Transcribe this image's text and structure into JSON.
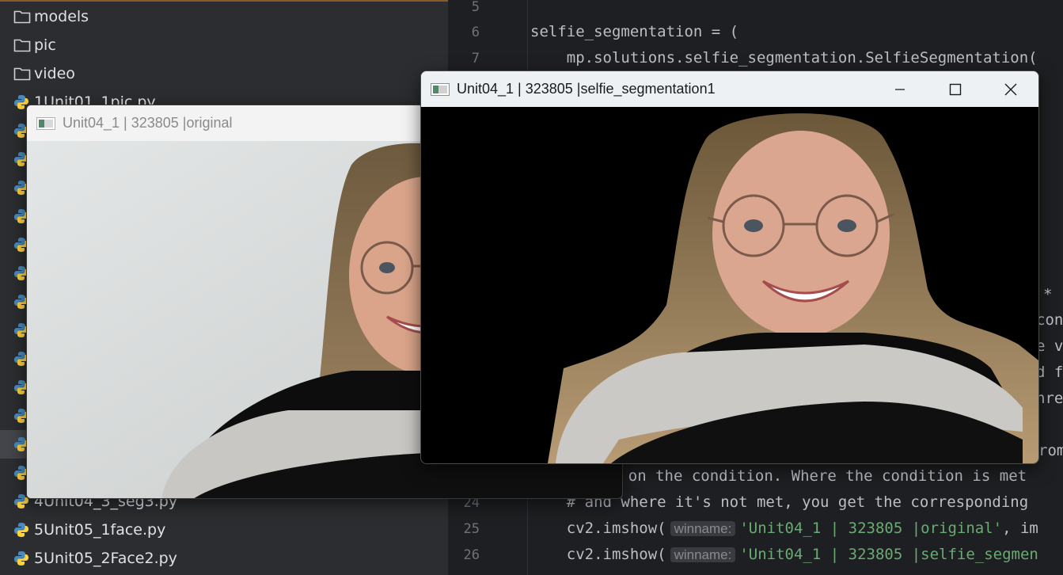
{
  "project": {
    "items": [
      {
        "name": "models",
        "type": "folder"
      },
      {
        "name": "pic",
        "type": "folder"
      },
      {
        "name": "video",
        "type": "folder"
      },
      {
        "name": "1Unit01_1pic.py",
        "type": "python"
      },
      {
        "name": "4Unit04_3_seg3.py",
        "type": "python"
      },
      {
        "name": "5Unit05_1face.py",
        "type": "python"
      },
      {
        "name": "5Unit05_2Face2.py",
        "type": "python"
      }
    ]
  },
  "editor": {
    "lines": [
      {
        "num": "5",
        "code": ""
      },
      {
        "num": "6",
        "code": "selfie_segmentation = ("
      },
      {
        "num": "7",
        "code": "    mp.solutions.selfie_segmentation.SelfieSegmentation("
      }
    ],
    "fragments": {
      "star": "*",
      "con": "con",
      "ev": "e v",
      "df": "d f",
      "hre": "hre",
      "rom": "rom"
    },
    "line23_text": "    on the condition. Where the condition is met",
    "line24": {
      "num": "24",
      "code": "    # and where it's not met, you get the corresponding"
    },
    "line25": {
      "num": "25",
      "call": "    cv2.imshow(",
      "hint": "winname:",
      "str": "'Unit04_1 | 323805 |original'",
      "rest": ", im"
    },
    "line26": {
      "num": "26",
      "call": "    cv2.imshow(",
      "hint": "winname:",
      "str": "'Unit04_1 | 323805 |selfie_segmen"
    }
  },
  "windows": {
    "original": {
      "title": "Unit04_1 | 323805 |original"
    },
    "segmentation": {
      "title": "Unit04_1 | 323805 |selfie_segmentation1",
      "controls": [
        "minimize-icon",
        "maximize-icon",
        "close-icon"
      ]
    }
  },
  "colors": {
    "ide_bg": "#1e1f22",
    "panel_bg": "#2b2d30",
    "string": "#6aab73",
    "comment": "#7a7e85",
    "seg_background": "#000000"
  }
}
